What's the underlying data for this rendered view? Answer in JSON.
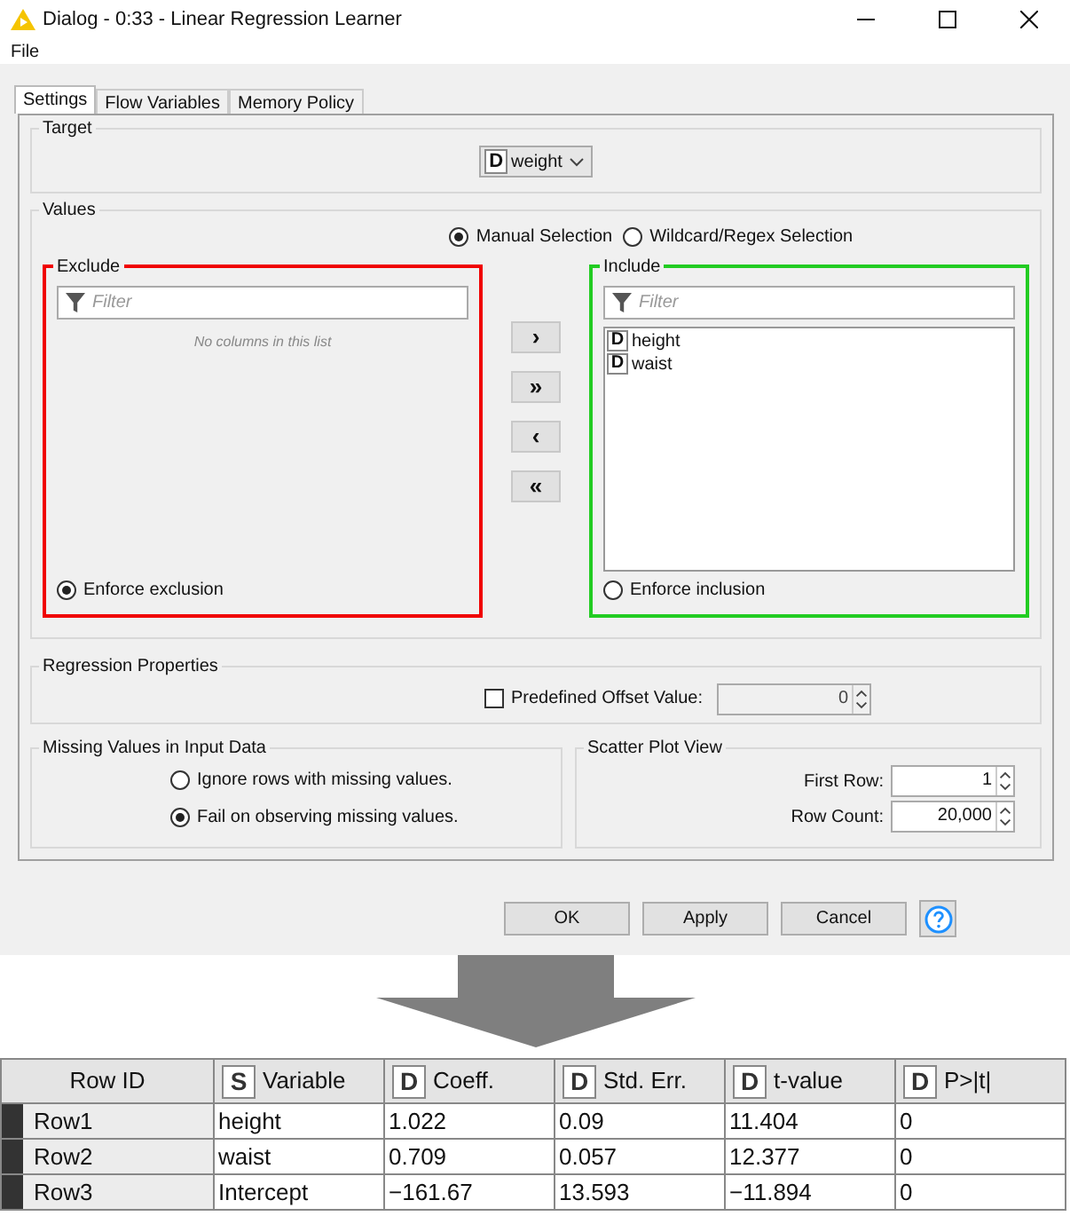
{
  "window": {
    "title": "Dialog - 0:33 - Linear Regression Learner"
  },
  "menu": [
    "File"
  ],
  "tabs": [
    {
      "label": "Settings",
      "selected": true
    },
    {
      "label": "Flow Variables",
      "selected": false
    },
    {
      "label": "Memory Policy",
      "selected": false
    }
  ],
  "target": {
    "title": "Target",
    "type": "D",
    "value": "weight"
  },
  "values": {
    "title": "Values",
    "modes": [
      {
        "label": "Manual Selection",
        "selected": true
      },
      {
        "label": "Wildcard/Regex Selection",
        "selected": false
      }
    ],
    "exclude": {
      "title": "Exclude",
      "filter_placeholder": "Filter",
      "empty_message": "No columns in this list",
      "enforce": {
        "label": "Enforce exclusion",
        "selected": true
      }
    },
    "move_buttons": [
      "›",
      "»",
      "‹",
      "«"
    ],
    "include": {
      "title": "Include",
      "filter_placeholder": "Filter",
      "items": [
        {
          "type": "D",
          "name": "height"
        },
        {
          "type": "D",
          "name": "waist"
        }
      ],
      "enforce": {
        "label": "Enforce inclusion",
        "selected": false
      }
    }
  },
  "regression": {
    "title": "Regression Properties",
    "offset": {
      "label": "Predefined Offset Value:",
      "checked": false,
      "disabled": true,
      "value": "0"
    }
  },
  "missing": {
    "title": "Missing Values in Input Data",
    "options": [
      {
        "label": "Ignore rows with missing values.",
        "selected": false
      },
      {
        "label": "Fail on observing missing values.",
        "selected": true
      }
    ]
  },
  "scatter": {
    "title": "Scatter Plot View",
    "fields": [
      {
        "label": "First Row:",
        "value": "1"
      },
      {
        "label": "Row Count:",
        "value": "20,000"
      }
    ]
  },
  "buttons": [
    "OK",
    "Apply",
    "Cancel"
  ],
  "table": {
    "columns": [
      {
        "label": "Row ID"
      },
      {
        "label": "Variable",
        "type": "S"
      },
      {
        "label": "Coeff.",
        "type": "D"
      },
      {
        "label": "Std. Err.",
        "type": "D"
      },
      {
        "label": "t-value",
        "type": "D"
      },
      {
        "label": "P>|t|",
        "type": "D"
      }
    ],
    "rows": [
      {
        "cells": [
          "Row1",
          "height",
          "1.022",
          "0.09",
          "11.404",
          "0"
        ]
      },
      {
        "cells": [
          "Row2",
          "waist",
          "0.709",
          "0.057",
          "12.377",
          "0"
        ]
      },
      {
        "cells": [
          "Row3",
          "Intercept",
          "−161.67",
          "13.593",
          "−11.894",
          "0"
        ]
      }
    ]
  }
}
